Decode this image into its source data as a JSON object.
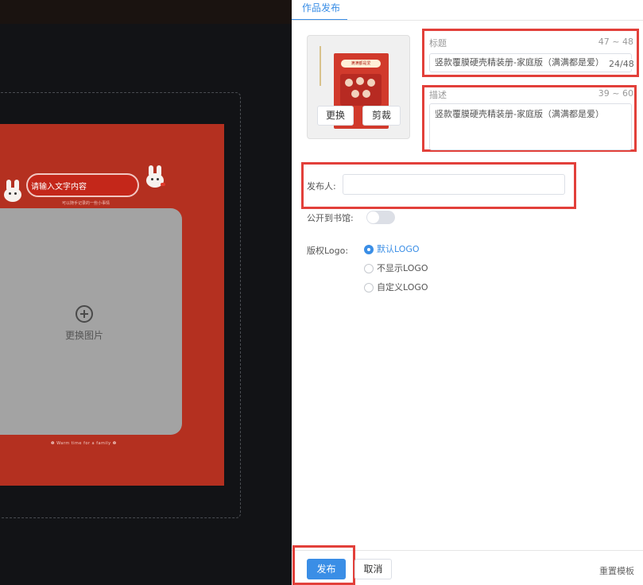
{
  "canvas": {
    "text_placeholder": "请输入文字内容",
    "text_sub": "可以随手记录的一些小事情",
    "change_image": "更换图片",
    "footer": "❶ Warm time for a family ❷"
  },
  "panel": {
    "tab_label": "作品发布",
    "thumbnail": {
      "cover_label": "满满都是爱",
      "replace_button": "更换",
      "crop_button": "剪裁"
    },
    "title_field": {
      "label": "标题",
      "range": "47 ~ 48",
      "value": "竖款覆膜硬壳精装册-家庭版（满满都是爱）",
      "counter": "24/48"
    },
    "desc_field": {
      "label": "描述",
      "range": "39 ~ 60",
      "value": "竖款覆膜硬壳精装册-家庭版（满满都是爱）"
    },
    "publisher": {
      "label": "发布人:",
      "value": ""
    },
    "library": {
      "label": "公开到书馆:",
      "enabled": false
    },
    "logo": {
      "label": "版权Logo:",
      "options": [
        "默认LOGO",
        "不显示LOGO",
        "自定义LOGO"
      ],
      "selected": "默认LOGO"
    },
    "footer": {
      "publish_button": "发布",
      "cancel_button": "取消",
      "reset_link": "重置模板"
    }
  },
  "colors": {
    "accent": "#3a8ee6",
    "highlight": "#e2403a",
    "canvas_page": "#b43020"
  }
}
